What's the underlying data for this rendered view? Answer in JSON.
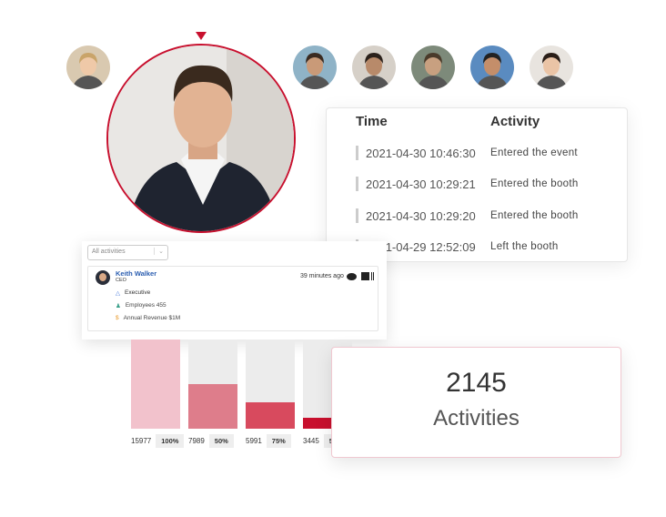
{
  "brand_color": "#c8102e",
  "attendees": [
    {
      "name": "attendee-1",
      "bg": "#d9c9b0",
      "hair": "#c9a46a",
      "skin": "#efc9a8"
    },
    {
      "name": "attendee-2",
      "bg": "#8fb3c7",
      "hair": "#3a2a20",
      "skin": "#c99a78"
    },
    {
      "name": "attendee-3",
      "bg": "#d6d0c8",
      "hair": "#2b211b",
      "skin": "#b88a6a"
    },
    {
      "name": "attendee-4",
      "bg": "#7d8a7a",
      "hair": "#4a3a2a",
      "skin": "#c8a080"
    },
    {
      "name": "attendee-5",
      "bg": "#5a8bc0",
      "hair": "#222",
      "skin": "#c48e6a"
    },
    {
      "name": "attendee-6",
      "bg": "#e8e4df",
      "hair": "#2a1e18",
      "skin": "#eac4a6"
    }
  ],
  "activity_table": {
    "headers": {
      "time": "Time",
      "activity": "Activity"
    },
    "rows": [
      {
        "time": "2021-04-30 10:46:30",
        "activity": "Entered the event"
      },
      {
        "time": "2021-04-30 10:29:21",
        "activity": "Entered the booth"
      },
      {
        "time": "2021-04-30 10:29:20",
        "activity": "Entered the booth"
      },
      {
        "time": "2021-04-29 12:52:09",
        "activity": "Left the booth"
      }
    ]
  },
  "contact_card": {
    "filter_value": "All activities",
    "name": "Keith Walker",
    "title": "CEO",
    "time_ago": "39 minutes ago",
    "role": "Executive",
    "employees": "Employees 455",
    "revenue": "Annual Revenue $1M"
  },
  "funnel": [
    {
      "value": "15977",
      "percent": "100%",
      "fill": 1.0,
      "color": "#f2c2cc"
    },
    {
      "value": "7989",
      "percent": "50%",
      "fill": 0.5,
      "color": "#de7d8b"
    },
    {
      "value": "5991",
      "percent": "75%",
      "fill": 0.3,
      "color": "#d84a5e"
    },
    {
      "value": "3445",
      "percent": "5",
      "fill": 0.12,
      "color": "#c8102e"
    }
  ],
  "stats": {
    "count": "2145",
    "label": "Activities"
  }
}
